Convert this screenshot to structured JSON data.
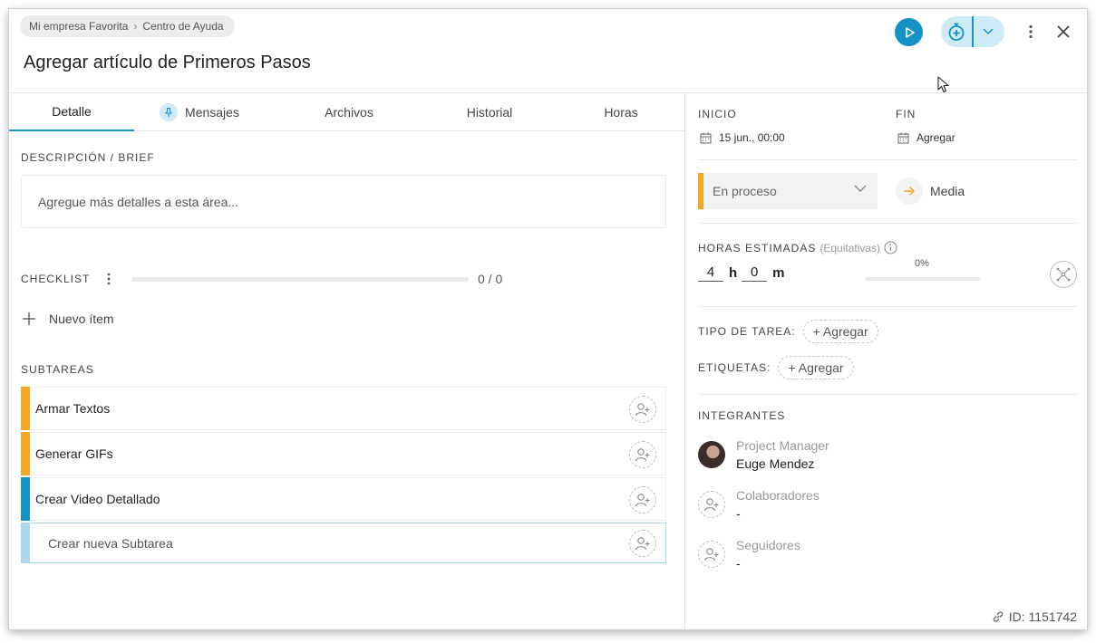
{
  "breadcrumb": {
    "items": [
      "Mi empresa Favorita",
      "Centro de Ayuda"
    ]
  },
  "task": {
    "title": "Agregar artículo de Primeros Pasos",
    "id_text": "ID: 1151742"
  },
  "colors": {
    "accent": "#1492c4",
    "accent_light": "#cdeaf7",
    "status_inprogress": "#f5a623"
  },
  "tabs": [
    {
      "label": "Detalle",
      "active": true
    },
    {
      "label": "Mensajes",
      "icon": "pin-icon"
    },
    {
      "label": "Archivos"
    },
    {
      "label": "Historial"
    },
    {
      "label": "Horas"
    }
  ],
  "description": {
    "label": "DESCRIPCIÓN / BRIEF",
    "placeholder": "Agregue más detalles a esta área..."
  },
  "checklist": {
    "label": "CHECKLIST",
    "count": "0 / 0",
    "progress": 0,
    "new_item_label": "Nuevo ítem"
  },
  "subtasks": {
    "label": "SUBTAREAS",
    "items": [
      {
        "label": "Armar Textos",
        "color": "#f5a623"
      },
      {
        "label": "Generar GIFs",
        "color": "#f5a623"
      },
      {
        "label": "Crear Video Detallado",
        "color": "#1492c4"
      }
    ],
    "new_label": "Crear nueva Subtarea",
    "new_color": "#a9d8ee"
  },
  "dates": {
    "start_label": "INICIO",
    "start_value": "15 jun., 00:00",
    "end_label": "FIN",
    "end_value": "Agregar"
  },
  "status": {
    "value": "En proceso"
  },
  "priority": {
    "value": "Media"
  },
  "hours": {
    "label": "HORAS ESTIMADAS",
    "sublabel": "(Equitativas)",
    "hours": "4",
    "hours_unit": "h",
    "minutes": "0",
    "minutes_unit": "m",
    "progress_label": "0%",
    "progress": 0
  },
  "task_type": {
    "label": "TIPO DE TAREA:",
    "add_label": "+ Agregar"
  },
  "tags": {
    "label": "ETIQUETAS:",
    "add_label": "+ Agregar"
  },
  "members": {
    "label": "INTEGRANTES",
    "project_manager": {
      "role": "Project Manager",
      "name": "Euge Mendez"
    },
    "collaborators": {
      "role": "Colaboradores",
      "name": "-"
    },
    "followers": {
      "role": "Seguidores",
      "name": "-"
    }
  }
}
